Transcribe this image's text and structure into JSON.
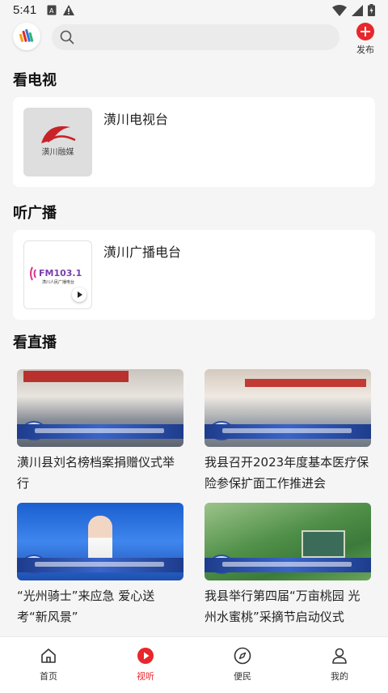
{
  "status": {
    "time": "5:41"
  },
  "header": {
    "publish_label": "发布",
    "search_placeholder": ""
  },
  "sections": {
    "tv": {
      "title": "看电视",
      "card_title": "潢川电视台",
      "thumb_text": "潢川融媒"
    },
    "radio": {
      "title": "听广播",
      "card_title": "潢川广播电台",
      "logo_text": "FM103.1",
      "logo_sub": "潢川人民广播电台"
    },
    "live": {
      "title": "看直播",
      "items": [
        {
          "caption": "潢川县刘名榜档案捐赠仪式举行"
        },
        {
          "caption": "我县召开2023年度基本医疗保险参保扩面工作推进会"
        },
        {
          "caption": "“光州骑士”来应急 爱心送考“新风景”"
        },
        {
          "caption": "我县举行第四届“万亩桃园 光州水蜜桃”采摘节启动仪式"
        }
      ]
    }
  },
  "colors": {
    "accent": "#e8262b",
    "background": "#f5f5f5"
  },
  "nav": {
    "items": [
      {
        "label": "首页",
        "icon": "home-icon"
      },
      {
        "label": "视听",
        "icon": "play-circle-icon",
        "active": true
      },
      {
        "label": "便民",
        "icon": "compass-icon"
      },
      {
        "label": "我的",
        "icon": "user-icon"
      }
    ]
  }
}
